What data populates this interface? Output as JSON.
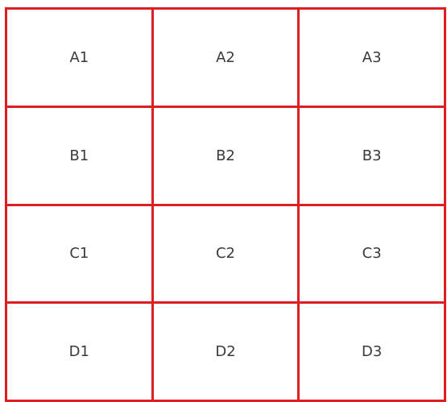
{
  "grid": {
    "line_color": "#e01e22",
    "rows": [
      [
        "A1",
        "A2",
        "A3"
      ],
      [
        "B1",
        "B2",
        "B3"
      ],
      [
        "C1",
        "C2",
        "C3"
      ],
      [
        "D1",
        "D2",
        "D3"
      ]
    ]
  }
}
